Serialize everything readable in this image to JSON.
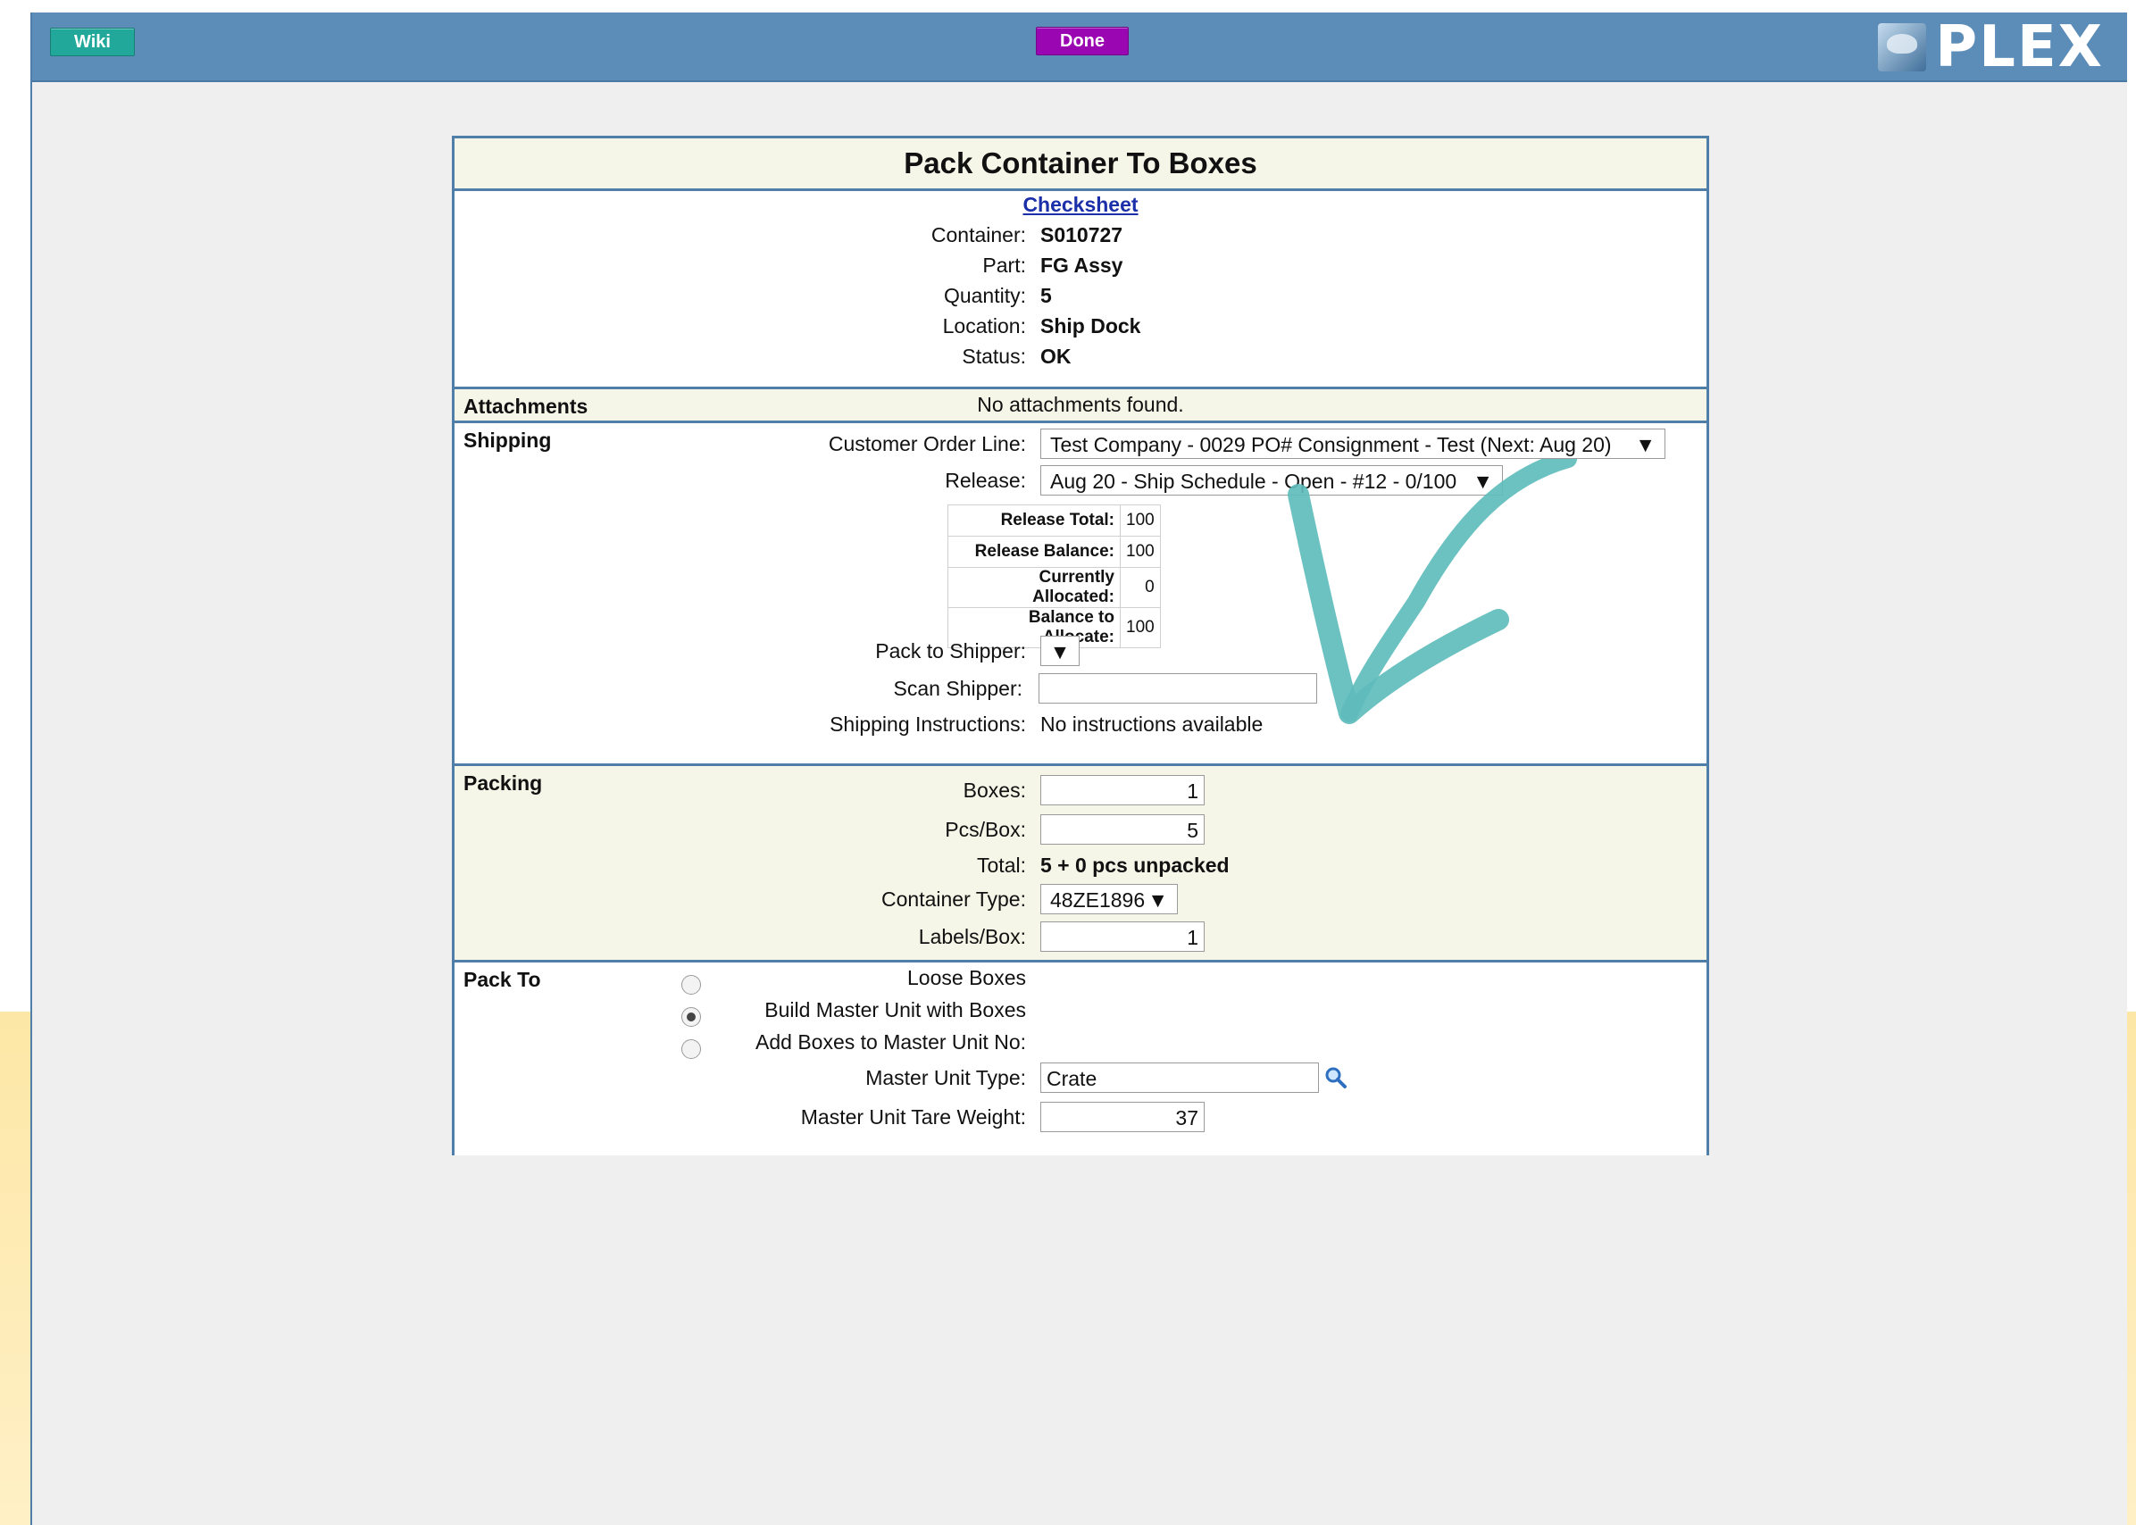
{
  "toolbar": {
    "wiki_label": "Wiki",
    "done_label": "Done",
    "logo_text": "PLEX"
  },
  "form": {
    "title": "Pack Container To Boxes",
    "checksheet_link": "Checksheet",
    "header_fields": [
      {
        "label": "Container:",
        "value": "S010727"
      },
      {
        "label": "Part:",
        "value": "FG Assy"
      },
      {
        "label": "Quantity:",
        "value": "5"
      },
      {
        "label": "Location:",
        "value": "Ship Dock"
      },
      {
        "label": "Status:",
        "value": "OK"
      }
    ],
    "attachments": {
      "section": "Attachments",
      "message": "No attachments found."
    },
    "shipping": {
      "section": "Shipping",
      "customer_order_line_label": "Customer Order Line:",
      "customer_order_line_value": "Test Company - 0029 PO# Consignment - Test (Next: Aug 20)",
      "release_label": "Release:",
      "release_value": "Aug 20 - Ship Schedule - Open - #12 - 0/100",
      "release_table": [
        {
          "label": "Release Total:",
          "value": "100"
        },
        {
          "label": "Release Balance:",
          "value": "100"
        },
        {
          "label": "Currently Allocated:",
          "value": "0"
        },
        {
          "label": "Balance to Allocate:",
          "value": "100"
        }
      ],
      "pack_to_shipper_label": "Pack to Shipper:",
      "scan_shipper_label": "Scan Shipper:",
      "scan_shipper_value": "",
      "instructions_label": "Shipping Instructions:",
      "instructions_value": "No instructions available"
    },
    "packing": {
      "section": "Packing",
      "boxes_label": "Boxes:",
      "boxes_value": "1",
      "pcs_label": "Pcs/Box:",
      "pcs_value": "5",
      "total_label": "Total:",
      "total_value": "5 + 0 pcs unpacked",
      "container_type_label": "Container Type:",
      "container_type_value": "48ZE1896",
      "labels_label": "Labels/Box:",
      "labels_value": "1"
    },
    "pack_to": {
      "section": "Pack To",
      "options": [
        {
          "label": "Loose Boxes",
          "selected": false
        },
        {
          "label": "Build Master Unit with Boxes",
          "selected": true
        },
        {
          "label": "Add Boxes to Master Unit No:",
          "selected": false
        }
      ],
      "master_unit_type_label": "Master Unit Type:",
      "master_unit_type_value": "Crate",
      "tare_weight_label": "Master Unit Tare Weight:",
      "tare_weight_value": "37"
    }
  },
  "icons": {
    "dropdown": "▼",
    "search": "magnifier-icon"
  },
  "colors": {
    "topbar": "#5b8db8",
    "wiki": "#22a89a",
    "done": "#9b06b3",
    "annotation_arrow": "#5fbcbc"
  }
}
